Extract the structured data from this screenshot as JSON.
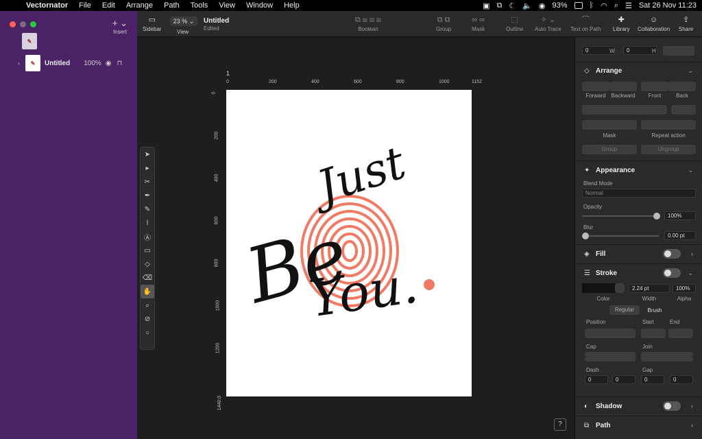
{
  "menubar": {
    "app_name": "Vectornator",
    "menus": [
      "File",
      "Edit",
      "Arrange",
      "Path",
      "Tools",
      "View",
      "Window",
      "Help"
    ],
    "battery": "93%",
    "datetime": "Sat 26 Nov  11:23"
  },
  "sidebar": {
    "insert_label": "Insert",
    "layer_name": "Untitled",
    "layer_opacity": "100%"
  },
  "toolbar": {
    "sidebar_label": "Sidebar",
    "zoom_value": "23 %",
    "view_label": "View",
    "doc_title": "Untitled",
    "doc_status": "Edited",
    "boolean_label": "Boolean",
    "group_label": "Group",
    "mask_label": "Mask",
    "outline_label": "Outline",
    "autotrace_label": "Auto Trace",
    "textonpath_label": "Text on Path",
    "library_label": "Library",
    "collaboration_label": "Collaboration",
    "share_label": "Share"
  },
  "canvas": {
    "artboard_number": "1",
    "ruler_h": [
      "0",
      "200",
      "400",
      "600",
      "800",
      "1000",
      "1152"
    ],
    "ruler_v": [
      "0",
      "200",
      "400",
      "600",
      "800",
      "1000",
      "1200",
      "1440.0"
    ],
    "art_text": {
      "line1": "Just",
      "line2": "Be",
      "line3": "You."
    },
    "art_colors": {
      "ink": "#111111",
      "print": "#f07a63"
    },
    "help_label": "?"
  },
  "inspector": {
    "top_fields": {
      "x": "0",
      "w_label": "W",
      "w": "0",
      "h_label": "H"
    },
    "arrange": {
      "title": "Arrange",
      "forward": "Forward",
      "backward": "Backward",
      "front": "Front",
      "back": "Back",
      "mask": "Mask",
      "repeat": "Repeat action",
      "group": "Group",
      "ungroup": "Ungroup"
    },
    "appearance": {
      "title": "Appearance",
      "blend_mode_label": "Blend Mode",
      "blend_mode": "Normal",
      "opacity_label": "Opacity",
      "opacity": "100%",
      "blur_label": "Blur",
      "blur": "0.00 pt"
    },
    "fill": {
      "title": "Fill"
    },
    "stroke": {
      "title": "Stroke",
      "width": "2.24 pt",
      "alpha": "100%",
      "color_label": "Color",
      "width_label": "Width",
      "alpha_label": "Alpha",
      "tab_regular": "Regular",
      "tab_brush": "Brush",
      "position_label": "Position",
      "start_label": "Start",
      "end_label": "End",
      "cap_label": "Cap",
      "join_label": "Join",
      "dash_label": "Dash",
      "gap_label": "Gap",
      "dash1": "0",
      "dash2": "0",
      "gap1": "0",
      "gap2": "0"
    },
    "shadow": {
      "title": "Shadow"
    },
    "path": {
      "title": "Path"
    }
  }
}
